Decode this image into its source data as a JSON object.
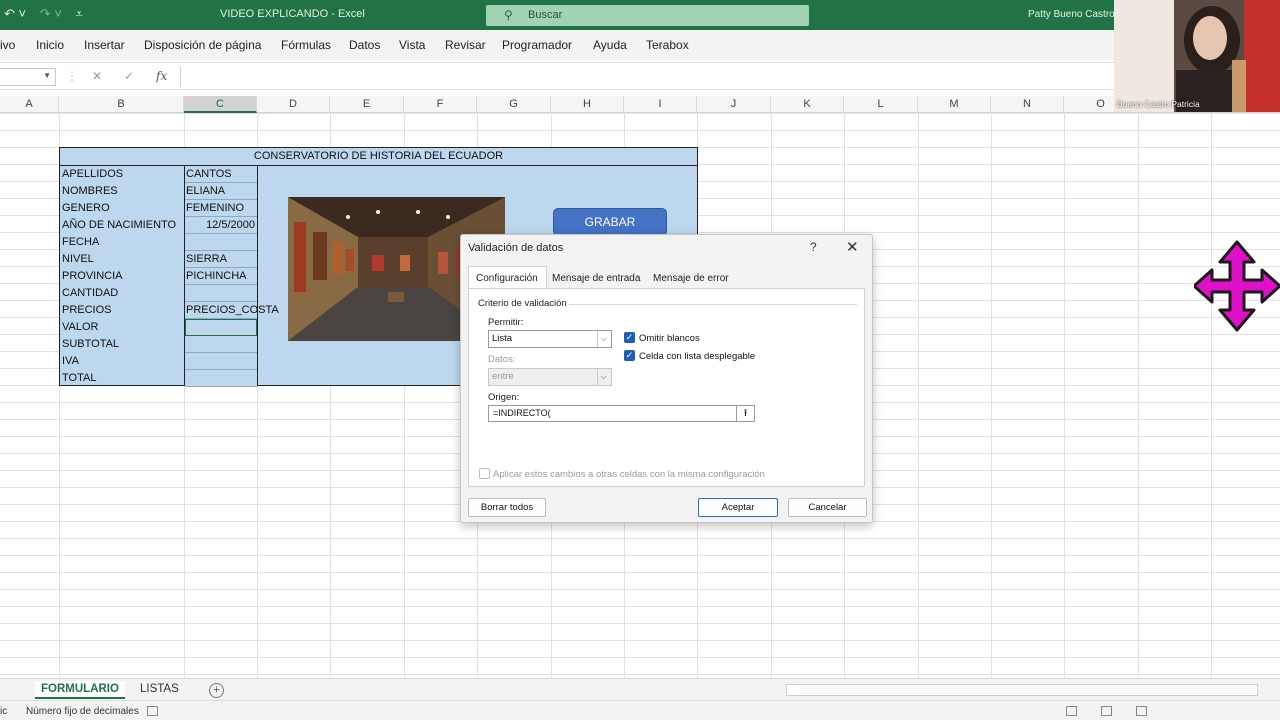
{
  "window": {
    "doc_title": "VIDEO EXPLICANDO  -  Excel",
    "search_placeholder": "Buscar",
    "user_name": "Patty Bueno Castro"
  },
  "menu": [
    "ivo",
    "Inicio",
    "Insertar",
    "Disposición de página",
    "Fórmulas",
    "Datos",
    "Vista",
    "Revisar",
    "Programador",
    "Ayuda",
    "Terabox"
  ],
  "formula_bar": {
    "fx": "fx",
    "content": ""
  },
  "columns": [
    "A",
    "B",
    "C",
    "D",
    "E",
    "F",
    "G",
    "H",
    "I",
    "J",
    "K",
    "L",
    "M",
    "N",
    "O"
  ],
  "form": {
    "title": "CONSERVATORIO DE HISTORIA DEL ECUADOR",
    "labels": [
      "APELLIDOS",
      "NOMBRES",
      "GENERO",
      "AÑO DE NACIMIENTO",
      "FECHA",
      "NIVEL",
      "PROVINCIA",
      "CANTIDAD",
      "PRECIOS",
      "VALOR",
      "SUBTOTAL",
      "IVA",
      "TOTAL"
    ],
    "values": [
      "CANTOS",
      "ELIANA",
      "FEMENINO",
      "12/5/2000",
      "",
      "SIERRA",
      "PICHINCHA",
      "",
      "PRECIOS_COSTA",
      "",
      "",
      "",
      ""
    ],
    "button_label": "GRABAR"
  },
  "dialog": {
    "title": "Validación de datos",
    "help": "?",
    "close": "✕",
    "tabs": [
      "Configuración",
      "Mensaje de entrada",
      "Mensaje de error"
    ],
    "section_title": "Criterio de validación",
    "permitir_label": "Permitir:",
    "permitir_value": "Lista",
    "datos_label": "Datos:",
    "datos_value": "entre",
    "omitir_label": "Omitir blancos",
    "omitir_checked": true,
    "celda_label": "Celda con lista desplegable",
    "celda_checked": true,
    "origen_label": "Origen:",
    "origen_value": "=INDIRECTO(",
    "apply_label": "Aplicar estos cambios a otras celdas con la misma configuración",
    "apply_checked": false,
    "borrar_label": "Borrar todos",
    "aceptar_label": "Aceptar",
    "cancelar_label": "Cancelar"
  },
  "webcam": {
    "name": "Bueno Castro Patricia"
  },
  "sheets": {
    "active": "FORMULARIO",
    "other": "LISTAS",
    "add": "+"
  },
  "status": {
    "left": "ic",
    "text": "Número fijo de decimales"
  }
}
